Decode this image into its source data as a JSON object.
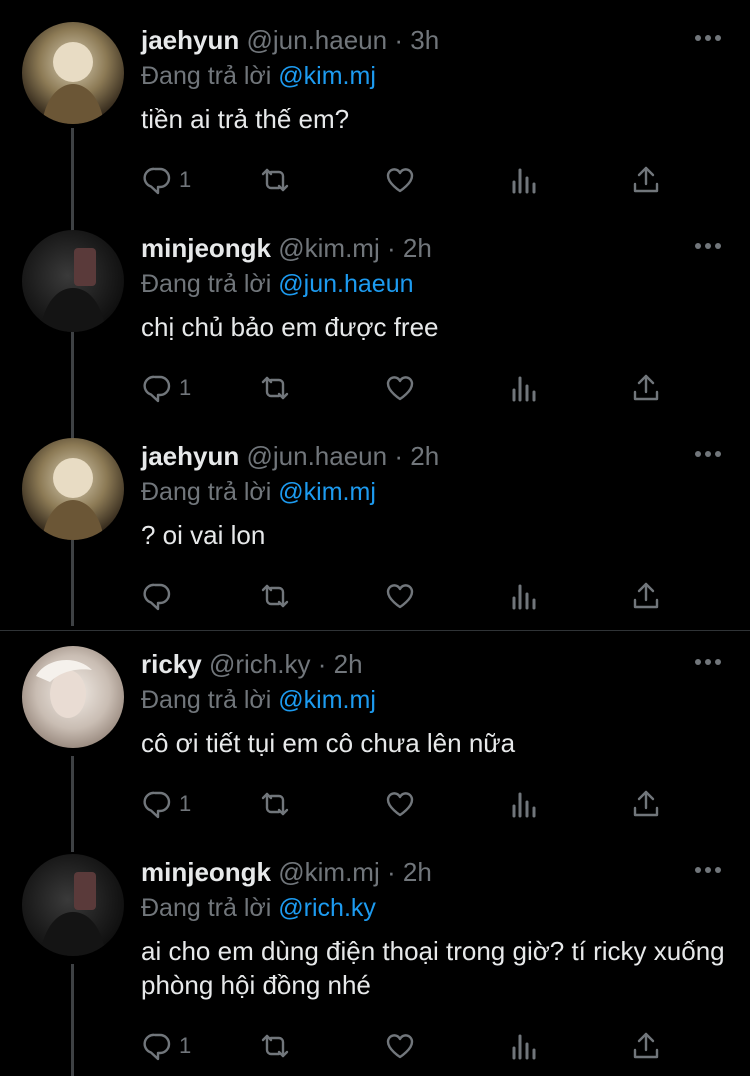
{
  "tweets": [
    {
      "name": "jaehyun",
      "handle": "@jun.haeun",
      "dot": "·",
      "time": "3h",
      "replying_prefix": "Đang trả lời",
      "mention": "@kim.mj",
      "text": "tiền ai trả thế em?",
      "reply_count": "1",
      "avatar": "jaehyun"
    },
    {
      "name": "minjeongk",
      "handle": "@kim.mj",
      "dot": "·",
      "time": "2h",
      "replying_prefix": "Đang trả lời",
      "mention": "@jun.haeun",
      "text": "chị chủ bảo em được free",
      "reply_count": "1",
      "avatar": "minjeongk"
    },
    {
      "name": "jaehyun",
      "handle": "@jun.haeun",
      "dot": "·",
      "time": "2h",
      "replying_prefix": "Đang trả lời",
      "mention": "@kim.mj",
      "text": "? oi vai lon",
      "reply_count": "",
      "avatar": "jaehyun"
    },
    {
      "name": "ricky",
      "handle": "@rich.ky",
      "dot": "·",
      "time": "2h",
      "replying_prefix": "Đang trả lời",
      "mention": "@kim.mj",
      "text": "cô ơi tiết tụi em cô chưa lên nữa",
      "reply_count": "1",
      "avatar": "ricky"
    },
    {
      "name": "minjeongk",
      "handle": "@kim.mj",
      "dot": "·",
      "time": "2h",
      "replying_prefix": "Đang trả lời",
      "mention": "@rich.ky",
      "text": "ai cho em dùng điện thoại trong giờ? tí ricky xuống phòng hội đồng nhé",
      "reply_count": "1",
      "avatar": "minjeongk"
    }
  ],
  "icons": {
    "reply": "reply-icon",
    "retweet": "retweet-icon",
    "like": "heart-icon",
    "views": "analytics-icon",
    "share": "share-icon",
    "more": "more-icon"
  },
  "colors": {
    "background": "#000000",
    "mention": "#1d9bf0",
    "muted": "#71767b",
    "text": "#e7e9ea"
  }
}
